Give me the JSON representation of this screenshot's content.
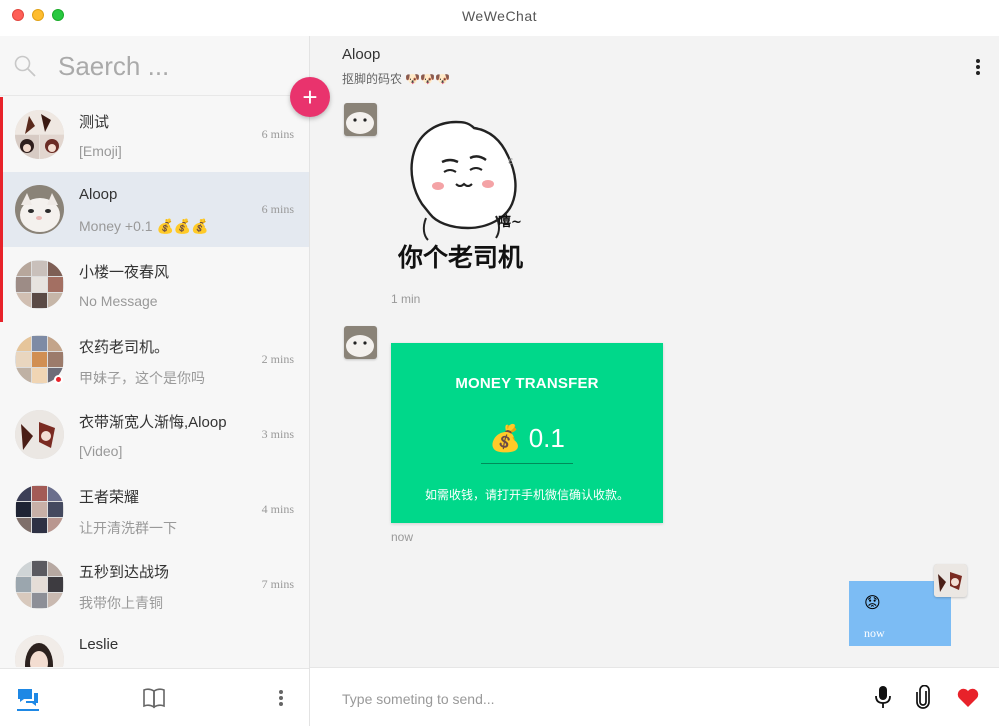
{
  "window": {
    "title": "WeWeChat"
  },
  "search": {
    "placeholder": "Saerch ..."
  },
  "add_button": {
    "label": "+"
  },
  "contacts": [
    {
      "name": "测试",
      "last_message": "[Emoji]",
      "time": "6 mins",
      "unread": true
    },
    {
      "name": "Aloop",
      "last_message": "Money +0.1 💰💰💰",
      "time": "6 mins",
      "unread": true,
      "active": true
    },
    {
      "name": "小楼一夜春风",
      "last_message": "No Message",
      "time": "",
      "unread": true
    },
    {
      "name": "农药老司机。",
      "last_message": "甲妹子，这个是你吗",
      "time": "2 mins",
      "online": true
    },
    {
      "name": "衣带渐宽人渐悔,Aloop",
      "last_message": "[Video]",
      "time": "3 mins"
    },
    {
      "name": "王者荣耀",
      "last_message": "让开清洗群一下",
      "time": "4 mins"
    },
    {
      "name": "五秒到达战场",
      "last_message": "我带你上青铜",
      "time": "7 mins"
    },
    {
      "name": "Leslie",
      "last_message": "",
      "time": ""
    }
  ],
  "chat": {
    "name": "Aloop",
    "signature": "抠脚的码农 🐶🐶🐶",
    "messages": [
      {
        "type": "sticker",
        "sticker_text": "你个老司机",
        "sticker_sound": "嘻~",
        "time": "1 min"
      },
      {
        "type": "transfer",
        "title": "MONEY TRANSFER",
        "amount": "💰 0.1",
        "note": "如需收钱，请打开手机微信确认收款。",
        "time": "now"
      },
      {
        "type": "emoji",
        "content": "😟",
        "time": "now",
        "self": true
      }
    ]
  },
  "composer": {
    "placeholder": "Type someting to send..."
  },
  "colors": {
    "accent": "#e9336d",
    "transfer": "#00d88a",
    "self_bubble": "#7cbcf4",
    "unread_bar": "#e8222a",
    "heart": "#e8222a"
  }
}
